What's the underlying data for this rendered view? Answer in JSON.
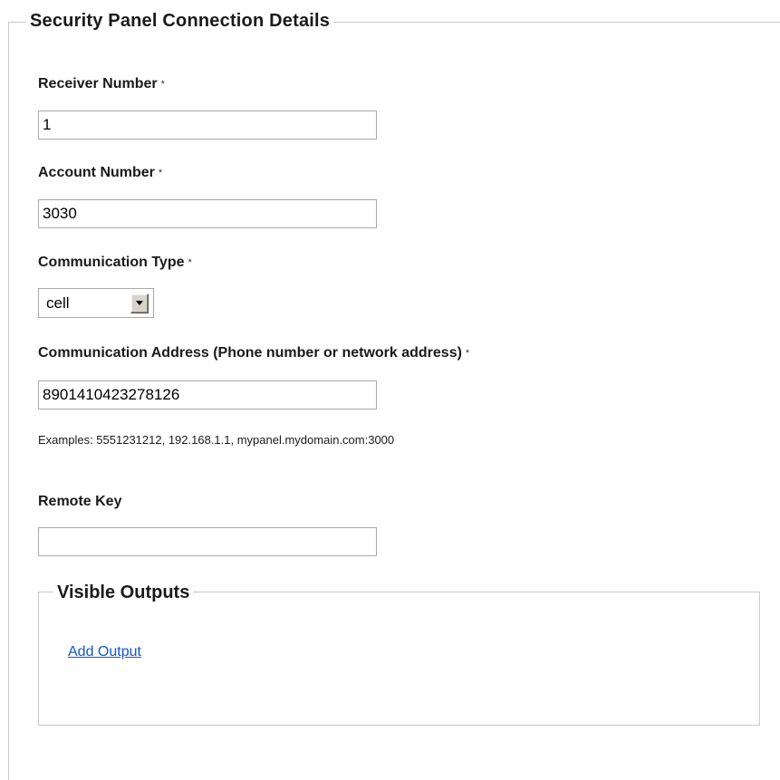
{
  "form": {
    "legend": "Security Panel Connection Details",
    "required_mark": "*",
    "receiver_number": {
      "label": "Receiver Number",
      "value": "1"
    },
    "account_number": {
      "label": "Account Number",
      "value": "3030"
    },
    "communication_type": {
      "label": "Communication Type",
      "selected": "cell"
    },
    "communication_address": {
      "label": "Communication Address (Phone number or network address)",
      "value": "8901410423278126",
      "hint": "Examples: 5551231212, 192.168.1.1, mypanel.mydomain.com:3000"
    },
    "remote_key": {
      "label": "Remote Key",
      "value": ""
    }
  },
  "visible_outputs": {
    "legend": "Visible Outputs",
    "add_link": "Add Output"
  },
  "colors": {
    "link": "#1155cc",
    "border": "#c8c8c8",
    "input_border": "#a9a9a9"
  },
  "icons": {
    "select_arrow": "chevron-down-icon"
  }
}
